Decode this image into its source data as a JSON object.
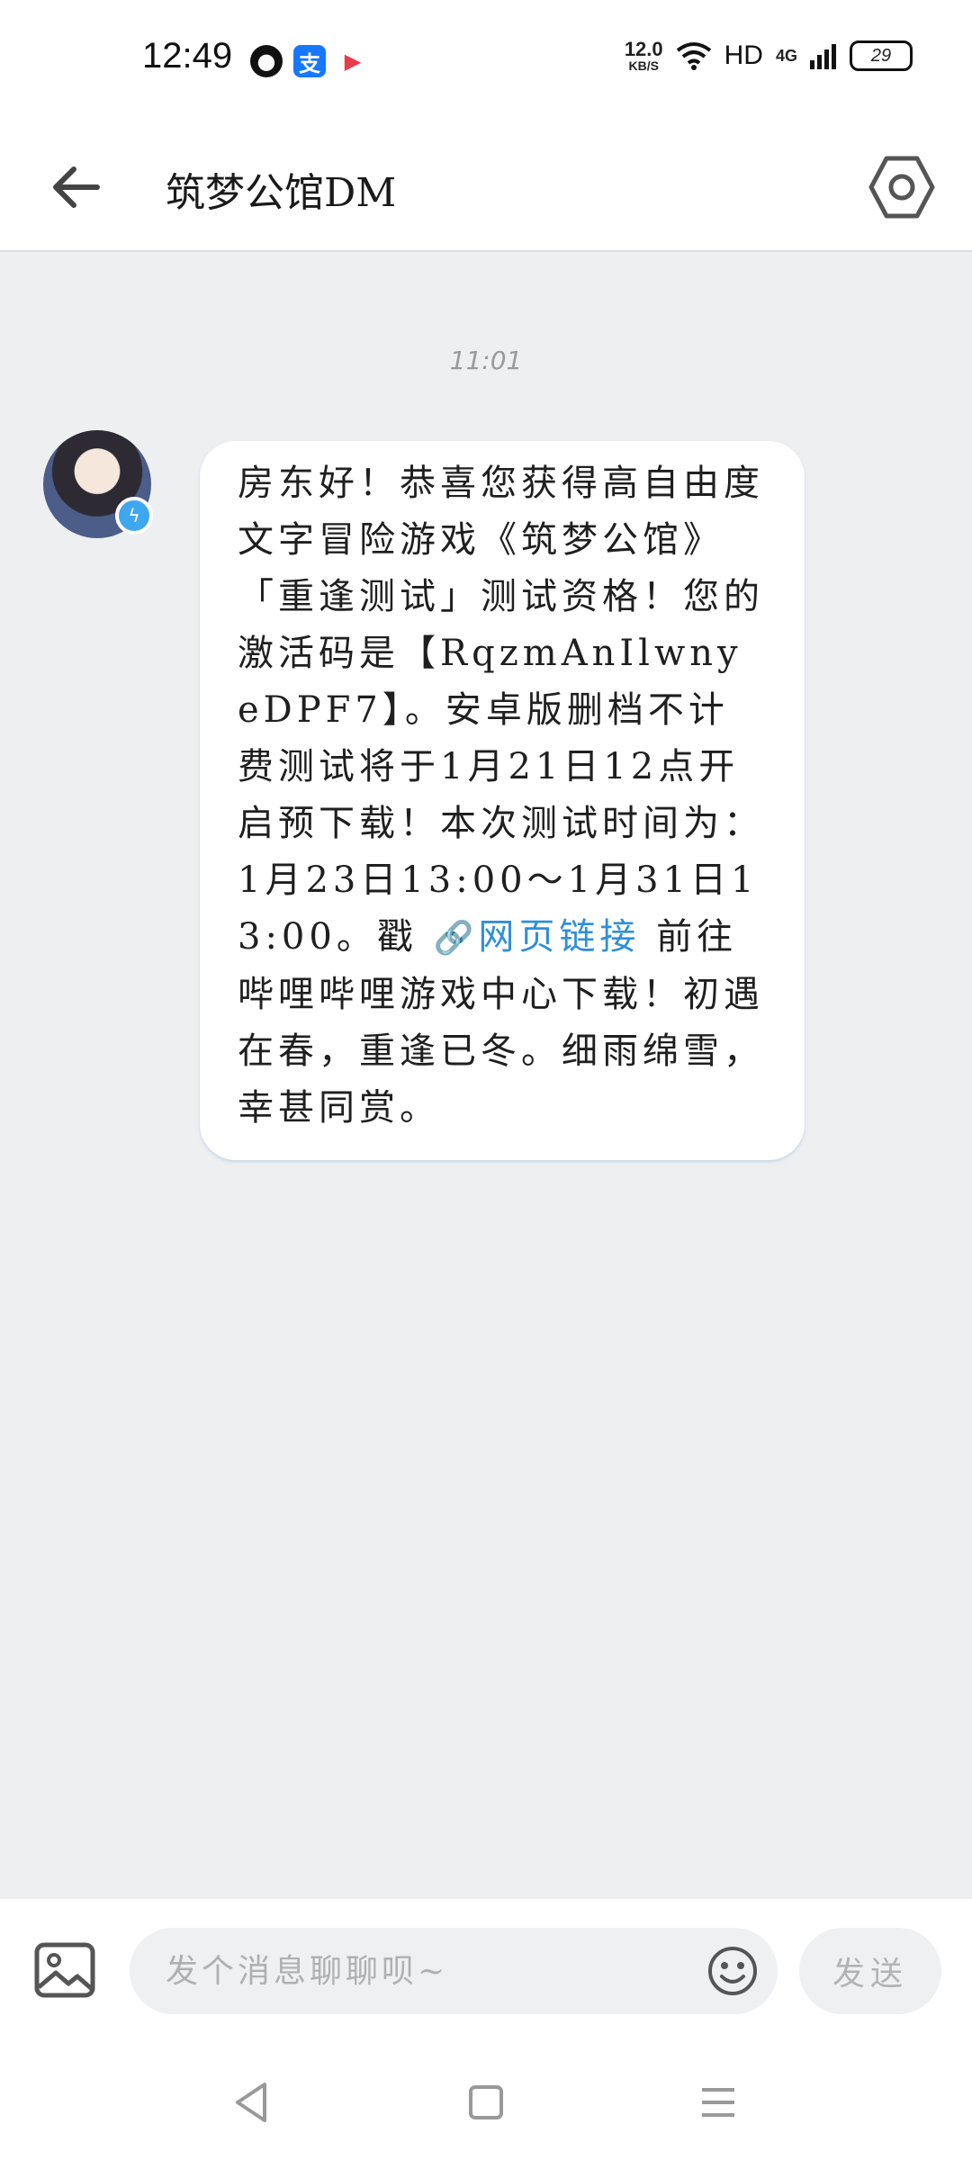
{
  "status_bar": {
    "time": "12:49",
    "net_speed": "12.0",
    "net_speed_unit": "KB/S",
    "hd": "HD",
    "network": "4G",
    "battery": "29"
  },
  "header": {
    "title": "筑梦公馆DM"
  },
  "chat": {
    "timestamp": "11:01",
    "message": {
      "text_before_link": "房东好！恭喜您获得高自由度文字冒险游戏《筑梦公馆》「重逢测试」测试资格！您的激活码是【RqzmAnIlwnyeDPF7】。安卓版删档不计费测试将于1月21日12点开启预下载！本次测试时间为：1月23日13:00～1月31日13:00。戳",
      "link_text": "网页链接",
      "text_after_link": "前往哔哩哔哩游戏中心下载！初遇在春，重逢已冬。细雨绵雪，幸甚同赏。"
    }
  },
  "input_bar": {
    "placeholder": "发个消息聊聊呗~",
    "send_label": "发送"
  },
  "icons": {
    "back": "back-arrow-icon",
    "settings": "settings-hexagon-icon",
    "image": "image-icon",
    "emoji": "emoji-icon",
    "link": "link-icon"
  },
  "colors": {
    "background": "#eeeff1",
    "link": "#2f8fd8",
    "bubble": "#ffffff"
  }
}
